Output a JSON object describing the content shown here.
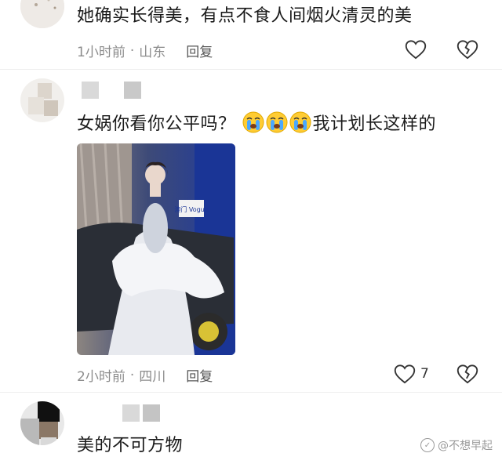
{
  "comments": [
    {
      "text": "她确实长得美，有点不食人间烟火清灵的美",
      "time": "1小时前",
      "location": "山东",
      "reply_label": "回复",
      "like_count": ""
    },
    {
      "text": "女娲你看你公平吗？",
      "emoji": [
        "crying-face-icon",
        "crying-face-icon",
        "crying-face-icon"
      ],
      "text_after_emoji": "我计划长这样的",
      "photo_badge": "澳门 Vogue",
      "time": "2小时前",
      "location": "四川",
      "reply_label": "回复",
      "like_count": "7"
    },
    {
      "text": "美的不可方物"
    }
  ],
  "watermark": "@不想早起",
  "colors": {
    "meta": "#8c8c8c",
    "text": "#1a1a1a",
    "icon": "#333333"
  }
}
